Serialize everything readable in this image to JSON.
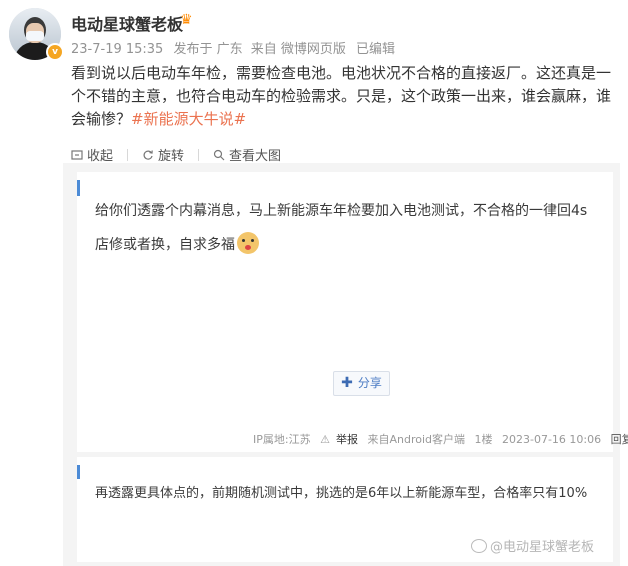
{
  "post": {
    "author": "电动星球蟹老板",
    "verified_badge": "v",
    "badge_icon": "crown-icon",
    "time": "23-7-19 15:35",
    "posted_in": "发布于 广东",
    "source": "来自 微博网页版",
    "edited": "已编辑",
    "body": "看到说以后电动车年检，需要检查电池。电池状况不合格的直接返厂。这还真是一个不错的主意，也符合电动车的检验需求。只是，这个政策一出来，谁会赢麻，谁会输惨？",
    "hashtag": "#新能源大牛说#"
  },
  "toolbar": {
    "collect": "收起",
    "rotate": "旋转",
    "view_large": "查看大图"
  },
  "image": {
    "comment1": "给你们透露个内幕消息，马上新能源车年检要加入电池测试，不合格的一律回4s店修或者换，自求多福",
    "share_label": "分享",
    "ip": "IP属地:江苏",
    "report": "举报",
    "client": "来自Android客户端",
    "floor": "1楼",
    "timestamp": "2023-07-16 10:06",
    "reply": "回复",
    "comment2": "再透露更具体点的，前期随机测试中，挑选的是6年以上新能源车型，合格率只有10%",
    "watermark": "@电动星球蟹老板"
  },
  "colors": {
    "hashtag": "#eb7350",
    "accent": "#4c8bd6",
    "meta": "#939393"
  }
}
